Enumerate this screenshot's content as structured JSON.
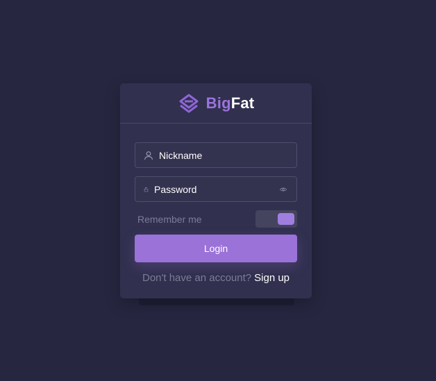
{
  "brand": {
    "part1": "Big",
    "part2": "Fat",
    "logo_icon": "layered-diamond-logo"
  },
  "form": {
    "nickname": {
      "placeholder": "Nickname",
      "icon": "user-icon"
    },
    "password": {
      "placeholder": "Password",
      "icon": "lock-icon",
      "toggle_icon": "eye-icon"
    },
    "remember": {
      "label": "Remember me",
      "checked": true
    },
    "login_label": "Login",
    "signup_prompt": "Don't have an account?",
    "signup_link": "Sign up"
  },
  "colors": {
    "background": "#262640",
    "card": "#31304f",
    "accent": "#9a72d8",
    "muted_text": "#7d7c97"
  }
}
